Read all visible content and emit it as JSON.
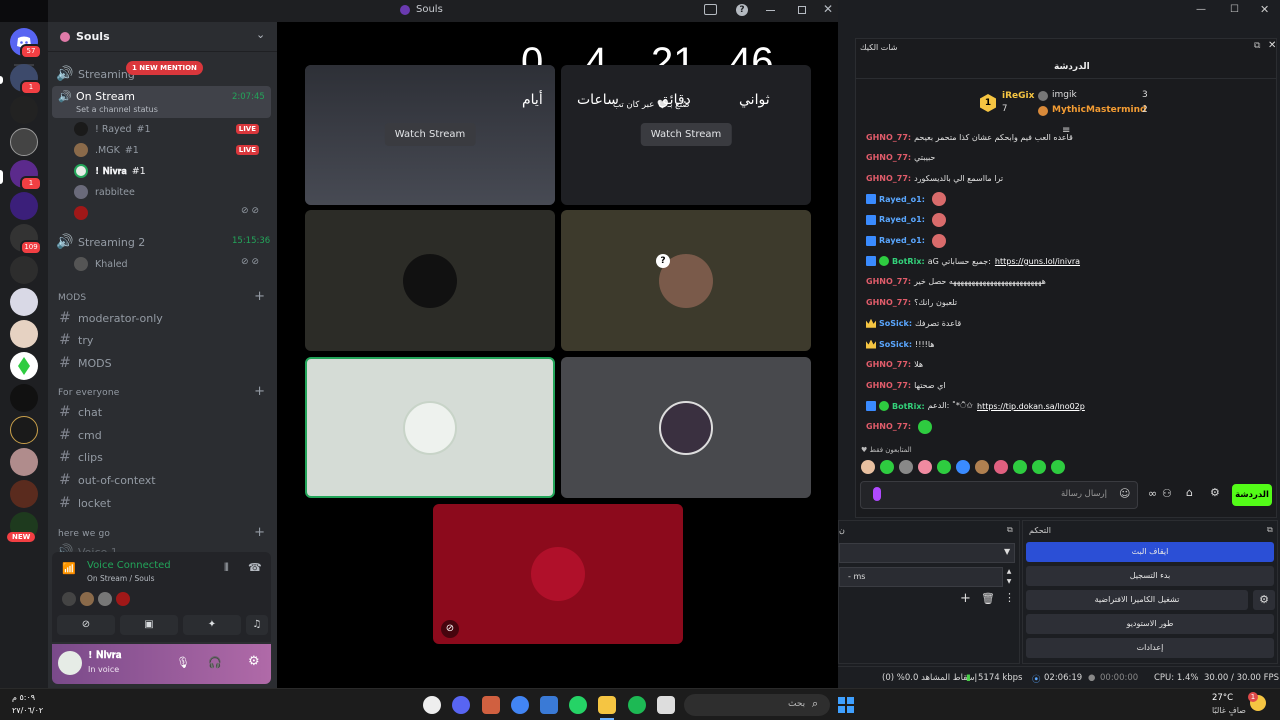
{
  "discord": {
    "window_title": "Souls",
    "server_name": "Souls",
    "server_badges": {
      "first": "57",
      "second": "1",
      "third": "1",
      "fourth": "109"
    },
    "new_label": "NEW",
    "channels": {
      "streaming": "Streaming",
      "new_mention": "1 NEW MENTION",
      "on_stream": "On Stream",
      "on_stream_time": "2:07:45",
      "set_status": "Set a channel status",
      "streaming2": "Streaming 2",
      "streaming2_time": "15:15:36"
    },
    "voice_users": [
      {
        "name": "! Rayed",
        "tag": "#1",
        "live": "LIVE"
      },
      {
        "name": ".MGK",
        "tag": "#1",
        "live": "LIVE"
      },
      {
        "name": "! 𝐍𝐢𝐯𝐫𝐚",
        "tag": "#1",
        "live": ""
      },
      {
        "name": "rabbitee",
        "tag": "",
        "live": ""
      },
      {
        "name": "",
        "tag": "",
        "live": ""
      }
    ],
    "streaming2_user": "Khaled",
    "categories": {
      "mods": "MODS",
      "everyone": "For everyone",
      "here_we_go": "here we go"
    },
    "mods_channels": [
      "moderator-only",
      "try",
      "MODS"
    ],
    "everyone_channels": [
      "chat",
      "cmd",
      "clips",
      "out-of-context",
      "locket"
    ],
    "cutoff_channel": "Voice 1",
    "voice_panel": {
      "status": "Voice Connected",
      "location": "On Stream / Souls"
    },
    "user_panel": {
      "username": "! 𝐍𝐢𝐯𝐫𝐚",
      "status": "In voice"
    }
  },
  "stage": {
    "countdown": {
      "days": "0",
      "hours": "4",
      "minutes": "21",
      "seconds": "46",
      "days_label": "أيام",
      "hours_label": "ساعات",
      "minutes_label": "دقائق",
      "seconds_label": "ثواني"
    },
    "stream_caption": "صُنع بـ🤍 عبر كان تب",
    "watch_stream": "Watch Stream"
  },
  "obs": {
    "chat_title": "شات الكيك",
    "chat_header": "الدردشة",
    "top_gifters": [
      {
        "name": "iReGix",
        "count": "7",
        "rank": "1"
      },
      {
        "name": "imgik",
        "count": "3",
        "rank": ""
      },
      {
        "name": "MythicMastermind",
        "count": "2",
        "rank": ""
      }
    ],
    "messages": [
      {
        "user": "GHNO_77:",
        "text": "قاعده العب فيم وابحكم عشان كذا متحمر بعيحم",
        "cls": "red",
        "badge": ""
      },
      {
        "user": "GHNO_77:",
        "text": "حبيبتي",
        "cls": "red",
        "badge": ""
      },
      {
        "user": "GHNO_77:",
        "text": "ترا مااسمع الي بالديسكورد",
        "cls": "red",
        "badge": ""
      },
      {
        "user": "Rayed_o1:",
        "text": "",
        "cls": "blue",
        "badge": "s"
      },
      {
        "user": "Rayed_o1:",
        "text": "",
        "cls": "blue",
        "badge": "s"
      },
      {
        "user": "Rayed_o1:",
        "text": "",
        "cls": "blue",
        "badge": "s"
      },
      {
        "user": "BotRix:",
        "text": "aG جميع حساباتي:",
        "cls": "green",
        "badge": "sg",
        "link": "https://guns.lol/inivra"
      },
      {
        "user": "GHNO_77:",
        "text": "هههههههههههههههههههههههههه حصل خير",
        "cls": "red",
        "badge": ""
      },
      {
        "user": "GHNO_77:",
        "text": "تلعبون رانك؟",
        "cls": "red",
        "badge": ""
      },
      {
        "user": "SoSick:",
        "text": "قاعدة تصرفك",
        "cls": "blue",
        "badge": "c"
      },
      {
        "user": "SoSick:",
        "text": "!!!!ها",
        "cls": "blue",
        "badge": "c"
      },
      {
        "user": "GHNO_77:",
        "text": "هلا",
        "cls": "red",
        "badge": ""
      },
      {
        "user": "GHNO_77:",
        "text": "اي صحتها",
        "cls": "red",
        "badge": ""
      },
      {
        "user": "BotRix:",
        "text": "الدعم: ˚*ੈ✩",
        "cls": "green",
        "badge": "sg",
        "link": "https://tip.dokan.sa/lno02p"
      },
      {
        "user": "GHNO_77:",
        "text": "",
        "cls": "red",
        "badge": ""
      }
    ],
    "followers_only": "المتابعون فقط",
    "send_placeholder": "إرسال رسالة",
    "chat_button": "الدردشة",
    "controls_title": "التحكم",
    "controls": [
      "ايقاف البث",
      "بدء التسجيل",
      "تشغيل الكاميرا الافتراضية",
      "طور الاستوديو",
      "إعدادات"
    ],
    "source_value": "ms",
    "status": {
      "dropped": "إسقاط المشاهد 0.0% (0)",
      "bitrate": "5174 kbps",
      "stream_time": "02:06:19",
      "rec_time": "00:00:00",
      "cpu": "CPU: 1.4%",
      "fps": "30.00 / 30.00 FPS"
    }
  },
  "taskbar": {
    "clock_time": "٥:٠٩ م",
    "clock_date": "٢٧/٠٦/٠٢",
    "search_placeholder": "بحث",
    "weather_temp": "27°C",
    "weather_desc": "صافٍ غالبًا",
    "weather_badge": "1"
  }
}
